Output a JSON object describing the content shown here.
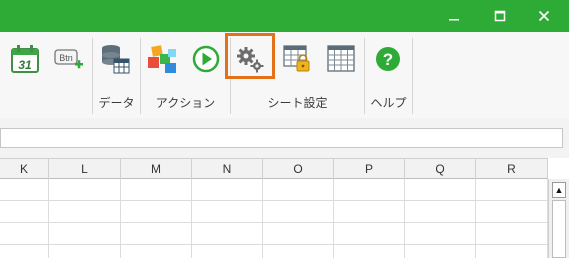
{
  "window": {
    "accent_color": "#2eaa37",
    "minimize_icon": "minimize-icon",
    "maximize_icon": "maximize-icon",
    "close_icon": "close-icon"
  },
  "ribbon": {
    "calendar_icon_text": "31",
    "button_icon_text": "Btn",
    "groups": {
      "data": "データ",
      "action": "アクション",
      "sheet_settings": "シート設定",
      "help": "ヘルプ"
    },
    "highlight_color": "#e3711a"
  },
  "formula_bar": {
    "value": ""
  },
  "grid": {
    "columns": [
      "K",
      "L",
      "M",
      "N",
      "O",
      "P",
      "Q",
      "R"
    ]
  },
  "scrollbar": {
    "up_arrow": "▲"
  }
}
